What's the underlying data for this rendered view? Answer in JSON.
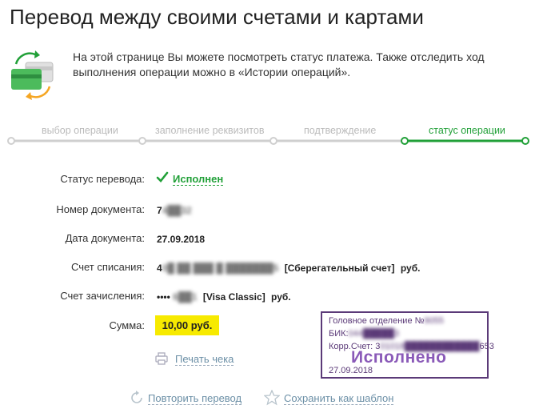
{
  "page": {
    "title": "Перевод между своими счетами и картами"
  },
  "intro": {
    "text": "На этой странице Вы можете посмотреть статус платежа. Также отследить ход выполнения операции можно в «Истории операций»."
  },
  "steps": [
    {
      "label": "выбор операции",
      "active": false
    },
    {
      "label": "заполнение реквизитов",
      "active": false
    },
    {
      "label": "подтверждение",
      "active": false
    },
    {
      "label": "статус операции",
      "active": true
    }
  ],
  "details": {
    "status_label": "Статус перевода:",
    "status_value": "Исполнен",
    "doc_number_label": "Номер документа:",
    "doc_number_visible": "7",
    "doc_number_masked": "4██32",
    "doc_date_label": "Дата документа:",
    "doc_date_value": "27.09.2018",
    "from_label": "Счет списания:",
    "from_account_visible": "4",
    "from_account_masked": "0█ ██ ███ █ ███████5",
    "from_account_type": "[Сберегательный счет]",
    "from_currency": "руб.",
    "to_label": "Счет зачисления:",
    "to_card_dots": "••••",
    "to_card_masked": "6██1",
    "to_card_type": "[Visa Classic]",
    "to_currency": "руб.",
    "sum_label": "Сумма:",
    "sum_value": "10,00 руб."
  },
  "actions": {
    "print_label": "Печать чека",
    "repeat_label": "Повторить перевод",
    "save_template_label": "Сохранить как шаблон"
  },
  "stamp": {
    "line1_label": "Головное отделение №",
    "line1_masked": "9055",
    "line2_label": "БИК:",
    "line2_masked": "044█████3",
    "line3_label": "Корр.Счет: 3",
    "line3_masked": "01018████████████",
    "line3_tail": "653",
    "big_text": "Исполнено",
    "date": "27.09.2018"
  },
  "colors": {
    "brand_green": "#21a038",
    "stamp_purple": "#5b3a78",
    "highlight_yellow": "#f7ea00"
  }
}
